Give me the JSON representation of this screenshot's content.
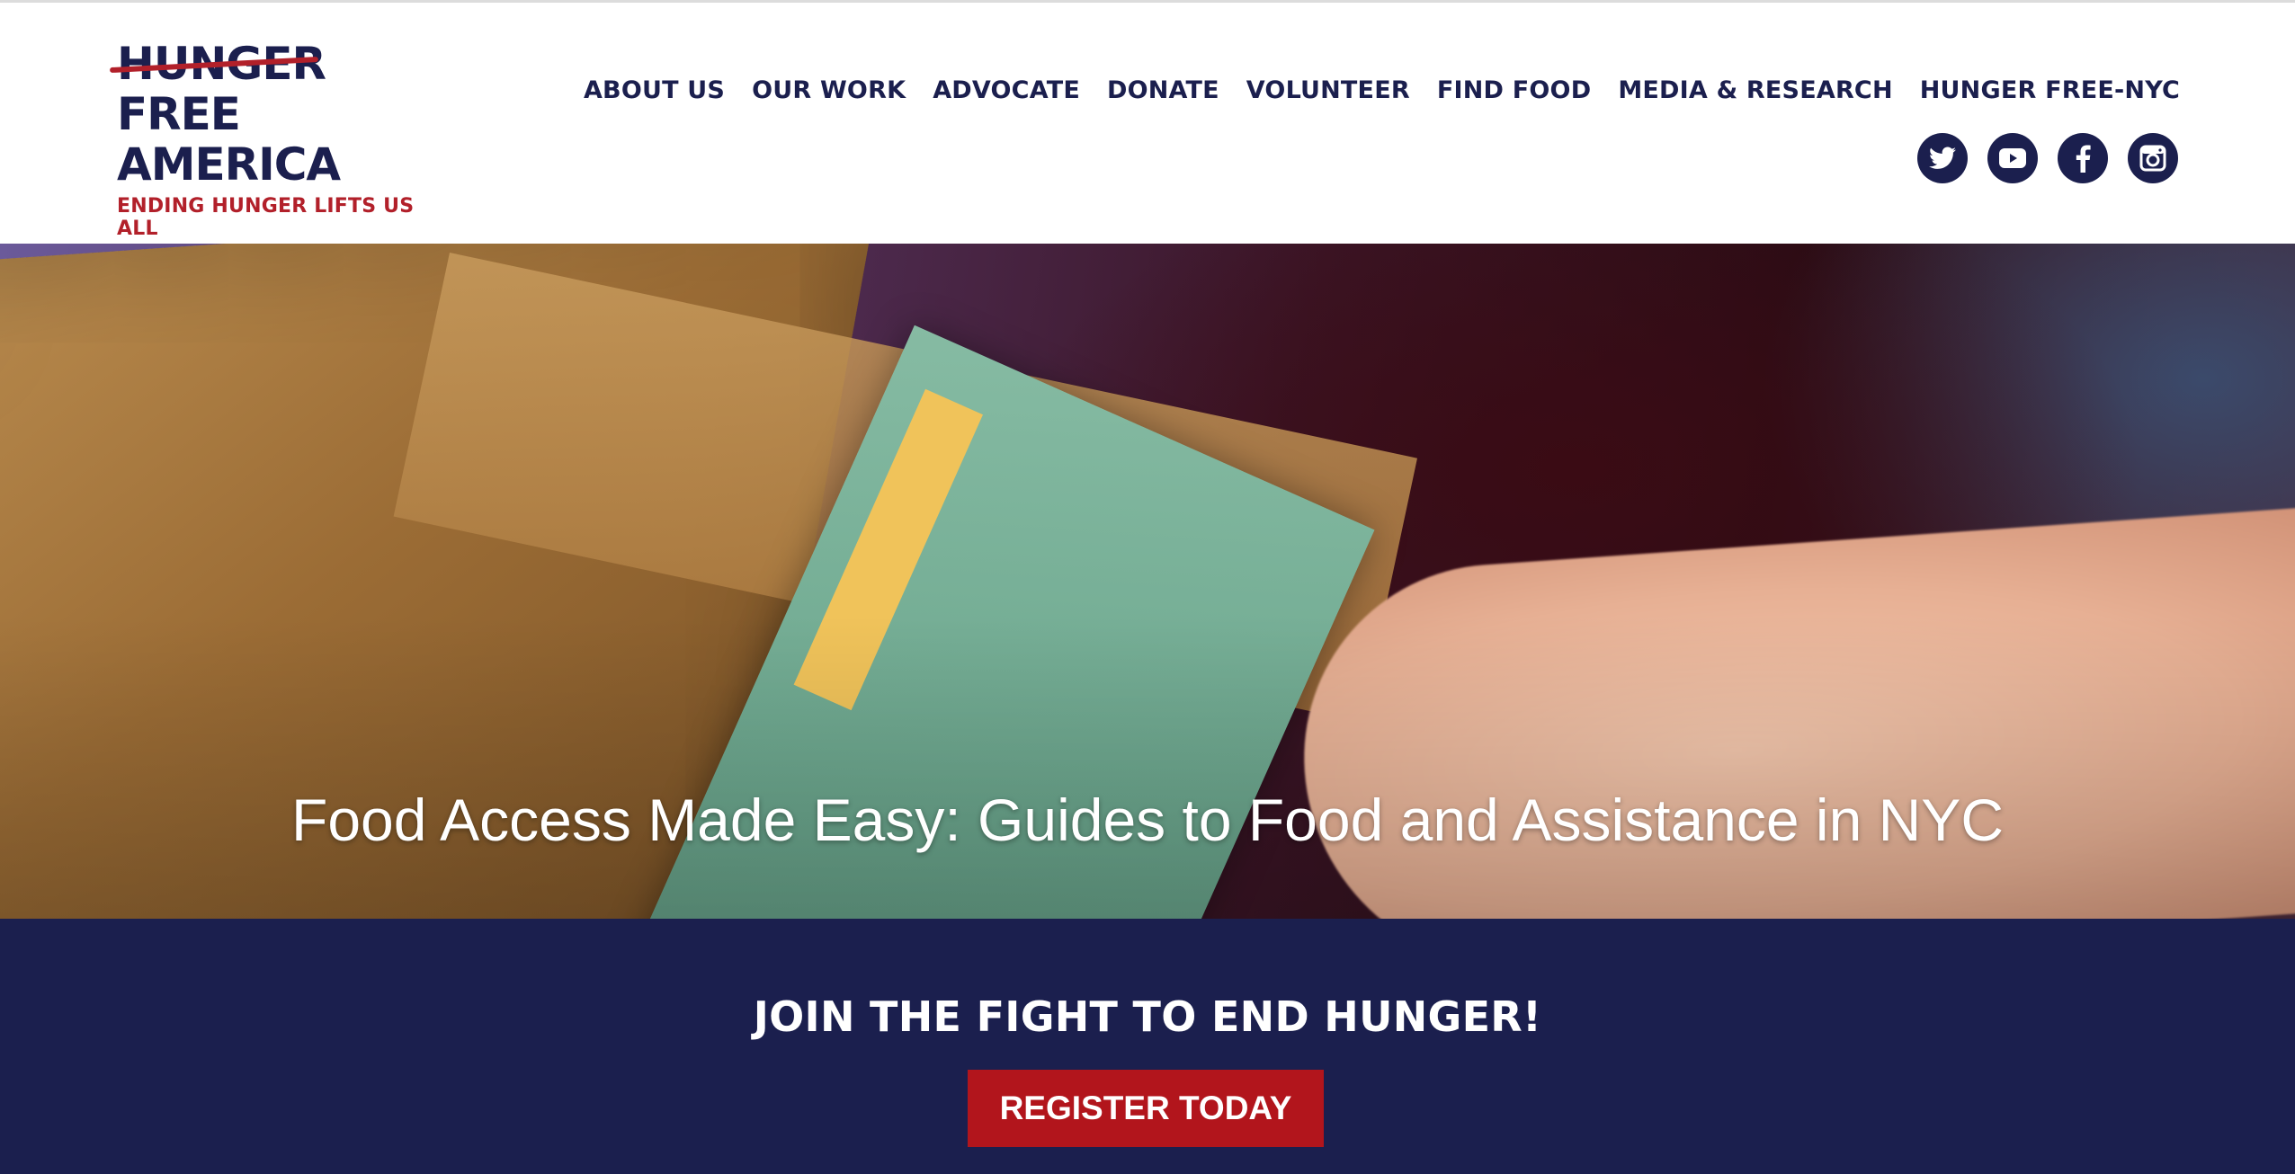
{
  "logo": {
    "line1": "HUNGER",
    "line2": "FREE",
    "line3": "AMERICA",
    "tagline": "ENDING HUNGER LIFTS US ALL"
  },
  "nav": {
    "items": [
      {
        "label": "ABOUT US"
      },
      {
        "label": "OUR WORK"
      },
      {
        "label": "ADVOCATE"
      },
      {
        "label": "DONATE"
      },
      {
        "label": "VOLUNTEER"
      },
      {
        "label": "FIND FOOD"
      },
      {
        "label": "MEDIA & RESEARCH"
      },
      {
        "label": "HUNGER FREE-NYC"
      }
    ]
  },
  "social": {
    "icons": [
      "twitter-icon",
      "youtube-icon",
      "facebook-icon",
      "instagram-icon"
    ]
  },
  "hero": {
    "title": "Food Access Made Easy: Guides to Food and Assistance in NYC"
  },
  "cta": {
    "title": "JOIN THE FIGHT TO END HUNGER!",
    "button_label": "REGISTER TODAY"
  },
  "colors": {
    "navy": "#1b1f4e",
    "brand_red": "#b2202a",
    "button_red": "#b2151c"
  }
}
